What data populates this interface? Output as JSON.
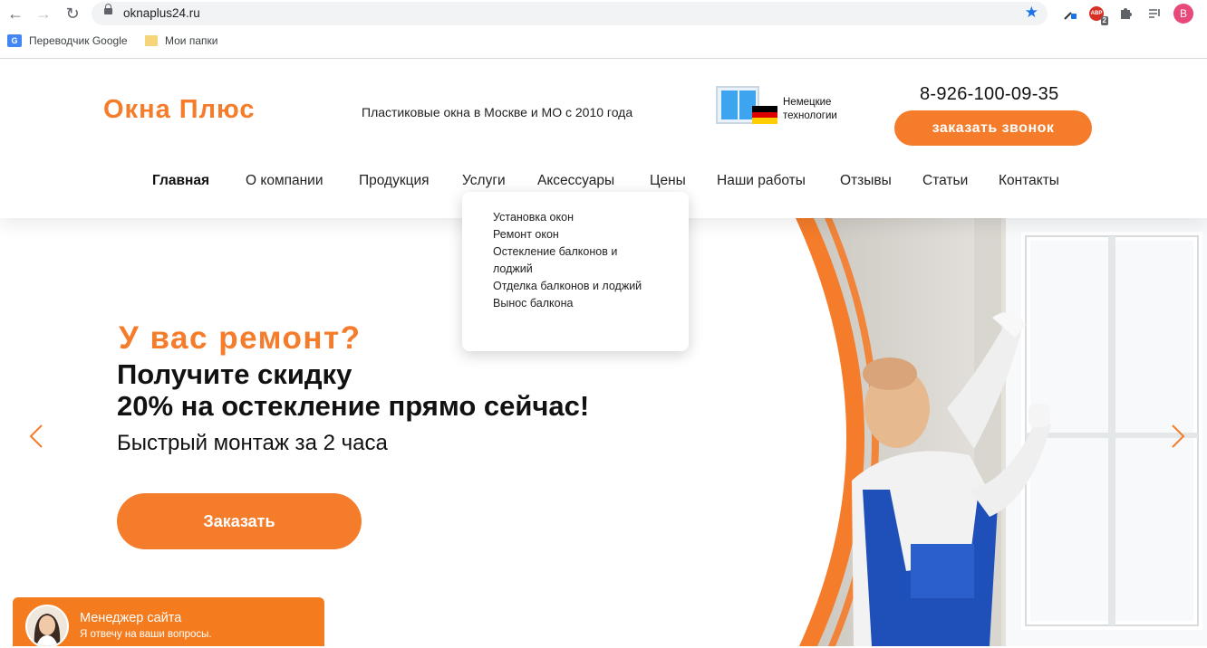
{
  "browser": {
    "url": "oknaplus24.ru",
    "bookmarks": [
      "Переводчик Google",
      "Мои папки"
    ],
    "extension_badge": "2",
    "extension_abbr": "ABP",
    "profile_initial": "B"
  },
  "header": {
    "logo": "Окна Плюс",
    "tagline": "Пластиковые окна в Москве и МО с 2010 года",
    "german_line1": "Немецкие",
    "german_line2": "технологии",
    "phone": "8-926-100-09-35",
    "call_button": "заказать звонок"
  },
  "nav": [
    "Главная",
    "О компании",
    "Продукция",
    "Услуги",
    "Аксессуары",
    "Цены",
    "Наши работы",
    "Отзывы",
    "Статьи",
    "Контакты"
  ],
  "services_dropdown": [
    "Установка окон",
    "Ремонт окон",
    "Остекление балконов и лоджий",
    "Отделка балконов и лоджий",
    "Вынос балкона"
  ],
  "hero": {
    "title": "У вас ремонт?",
    "subtitle_line1": "Получите скидку",
    "subtitle_line2": "20% на остекление прямо сейчас!",
    "fast": "Быстрый монтаж за 2 часа",
    "order_button": "Заказать"
  },
  "chat": {
    "name": "Менеджер сайта",
    "subtitle": "Я отвечу на ваши вопросы."
  },
  "colors": {
    "accent": "#f47c2a",
    "flag": [
      "#000000",
      "#dd0000",
      "#ffce00"
    ]
  }
}
